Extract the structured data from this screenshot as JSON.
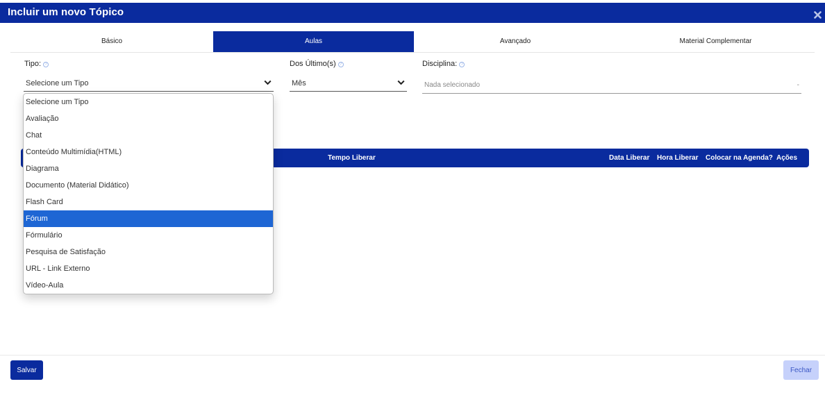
{
  "modal": {
    "title": "Incluir um novo Tópico"
  },
  "tabs": [
    {
      "label": "Básico",
      "active": false
    },
    {
      "label": "Aulas",
      "active": true
    },
    {
      "label": "Avançado",
      "active": false
    },
    {
      "label": "Material Complementar",
      "active": false
    }
  ],
  "form": {
    "tipo": {
      "label": "Tipo:",
      "value": "Selecione um Tipo"
    },
    "ultimos": {
      "label": "Dos Último(s)",
      "value": "Mês"
    },
    "disciplina": {
      "label": "Disciplina:",
      "placeholder": "Nada selecionado",
      "caret": "-"
    }
  },
  "table": {
    "headers": [
      "Tempo Liberar",
      "Data Liberar",
      "Hora Liberar",
      "Colocar na Agenda?",
      "Ações"
    ]
  },
  "dropdown": {
    "options": [
      "Selecione um Tipo",
      "Avaliação",
      "Chat",
      "Conteúdo Multimídia(HTML)",
      "Diagrama",
      "Documento (Material Didático)",
      "Flash Card",
      "Fórum",
      "Fórmulário",
      "Pesquisa de Satisfação",
      "URL - Link Externo",
      "Vídeo-Aula"
    ],
    "selected": "Fórum"
  },
  "footer": {
    "save_label": "Salvar",
    "close_label": "Fechar"
  },
  "colors": {
    "primary": "#0a2b9e",
    "highlight": "#1e66d4",
    "close_bg": "#c6d1fb"
  }
}
